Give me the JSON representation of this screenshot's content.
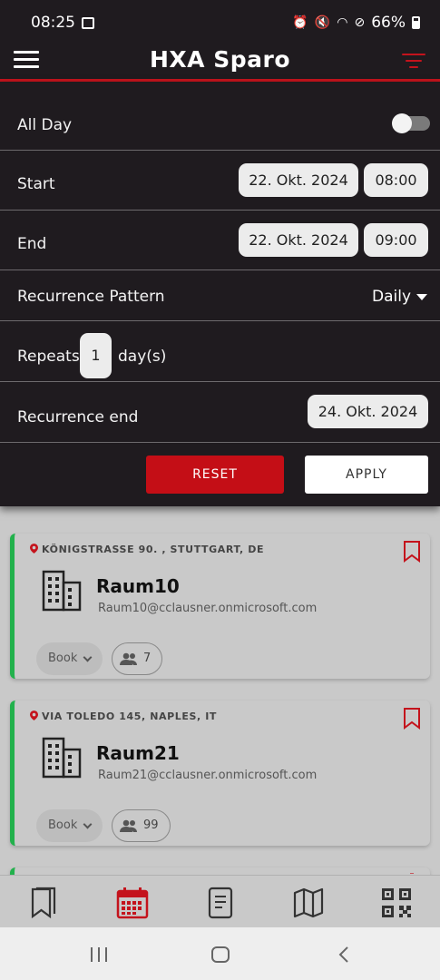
{
  "status_bar": {
    "time": "08:25",
    "battery": "66%"
  },
  "header": {
    "title": "HXA Sparo"
  },
  "filter": {
    "all_day": {
      "label": "All Day",
      "enabled": false
    },
    "start": {
      "label": "Start",
      "date": "22. Okt. 2024",
      "time": "08:00"
    },
    "end": {
      "label": "End",
      "date": "22. Okt. 2024",
      "time": "09:00"
    },
    "recurrence_pattern": {
      "label": "Recurrence Pattern",
      "value": "Daily"
    },
    "repeats": {
      "label": "Repeats",
      "value": "1",
      "unit": "day(s)"
    },
    "recurrence_end": {
      "label": "Recurrence end",
      "date": "24. Okt. 2024"
    },
    "reset_label": "RESET",
    "apply_label": "APPLY"
  },
  "rooms": [
    {
      "address": "KÖNIGSTRASSE 90. , STUTTGART, DE",
      "name": "Raum10",
      "email": "Raum10@cclausner.onmicrosoft.com",
      "book_label": "Book",
      "capacity": "7"
    },
    {
      "address": "VIA TOLEDO 145, NAPLES, IT",
      "name": "Raum21",
      "email": "Raum21@cclausner.onmicrosoft.com",
      "book_label": "Book",
      "capacity": "99"
    }
  ],
  "colors": {
    "accent": "#c4131c",
    "available": "#22b14c",
    "panel": "#1f1b1f"
  },
  "bottom_nav": [
    {
      "icon": "bookmarks-icon",
      "active": false
    },
    {
      "icon": "calendar-icon",
      "active": true
    },
    {
      "icon": "document-icon",
      "active": false
    },
    {
      "icon": "map-icon",
      "active": false
    },
    {
      "icon": "qr-code-icon",
      "active": false
    }
  ]
}
